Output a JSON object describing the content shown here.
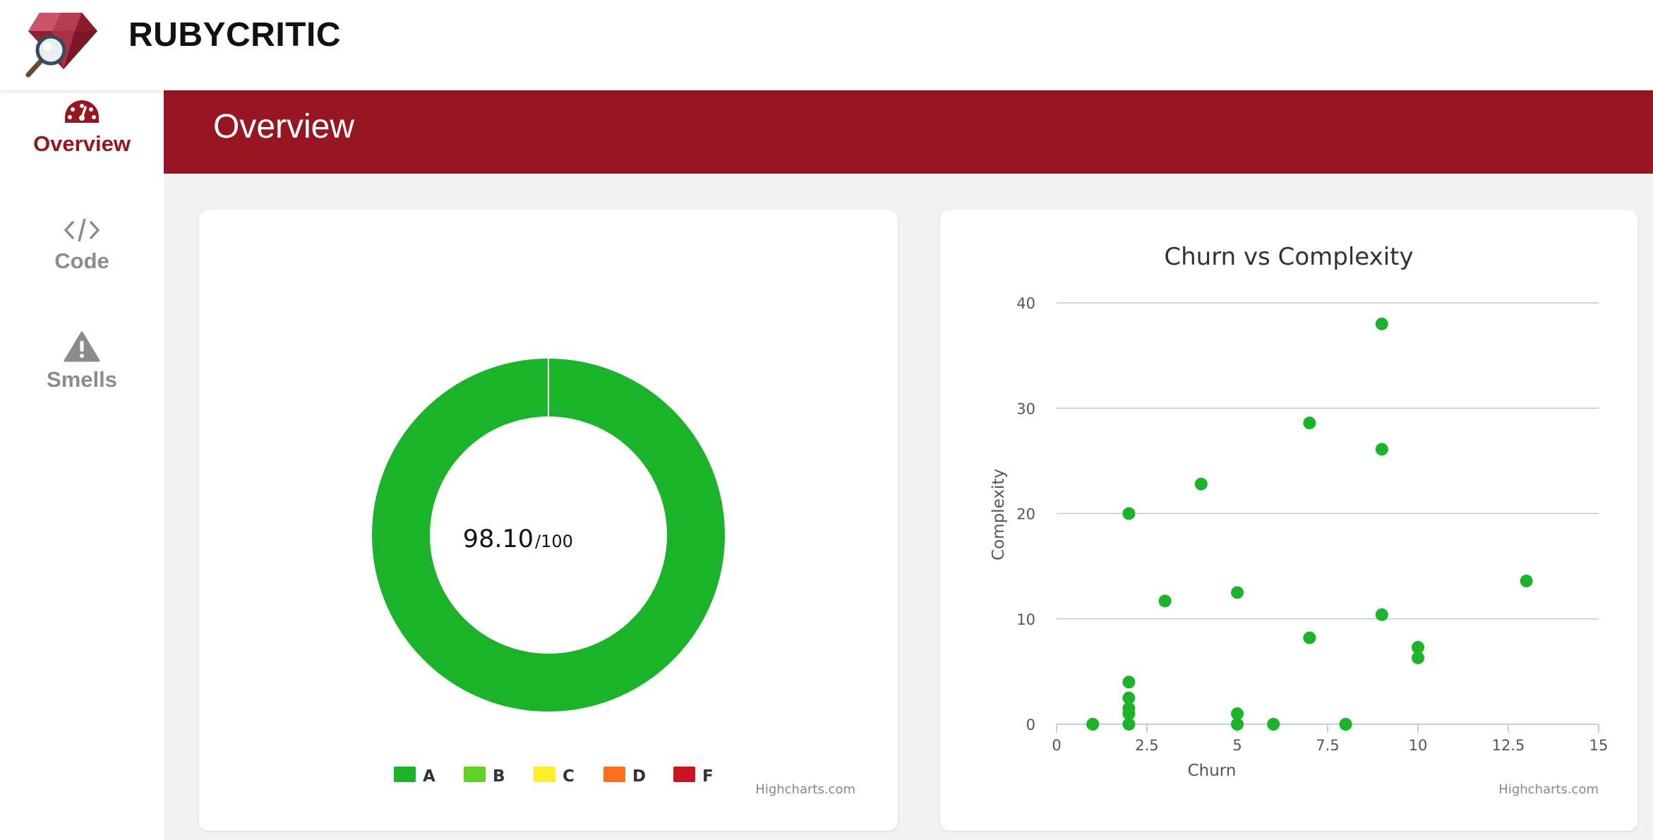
{
  "app": {
    "name": "RUBYCRITIC"
  },
  "sidebar": {
    "items": [
      {
        "label": "Overview",
        "icon": "dashboard-icon",
        "active": true
      },
      {
        "label": "Code",
        "icon": "code-icon",
        "active": false
      },
      {
        "label": "Smells",
        "icon": "warning-icon",
        "active": false
      }
    ]
  },
  "header": {
    "title": "Overview"
  },
  "colors": {
    "brand": "#981522",
    "grade_A": "#1bb32a",
    "grade_B": "#5fd128",
    "grade_C": "#ffee2e",
    "grade_D": "#ff6e1e",
    "grade_F": "#c8141e"
  },
  "score_card": {
    "score": "98.10",
    "max": "/100",
    "credit": "Highcharts.com"
  },
  "chart_data": [
    {
      "type": "pie",
      "title": "",
      "categories": [
        "A",
        "B",
        "C",
        "D",
        "F"
      ],
      "values": [
        100,
        0,
        0,
        0,
        0
      ],
      "center_label": "98.10/100",
      "legend_position": "bottom"
    },
    {
      "type": "scatter",
      "title": "Churn vs Complexity",
      "xlabel": "Churn",
      "ylabel": "Complexity",
      "xlim": [
        0,
        15
      ],
      "ylim": [
        0,
        40
      ],
      "x_ticks": [
        "0",
        "2.5",
        "5",
        "7.5",
        "10",
        "12.5",
        "15"
      ],
      "y_ticks": [
        "0",
        "10",
        "20",
        "30",
        "40"
      ],
      "grid": true,
      "series": [
        {
          "x": [
            1,
            2,
            2,
            2,
            2,
            2,
            2,
            3,
            4,
            5,
            5,
            5,
            6,
            7,
            7,
            8,
            9,
            9,
            9,
            10,
            10,
            13
          ],
          "y": [
            0,
            0,
            1,
            1.5,
            2.5,
            4,
            20,
            11.7,
            22.8,
            0,
            1,
            12.5,
            0,
            8.2,
            28.6,
            0,
            10.4,
            26.1,
            38,
            6.3,
            7.3,
            13.6
          ]
        }
      ],
      "credit": "Highcharts.com"
    }
  ]
}
